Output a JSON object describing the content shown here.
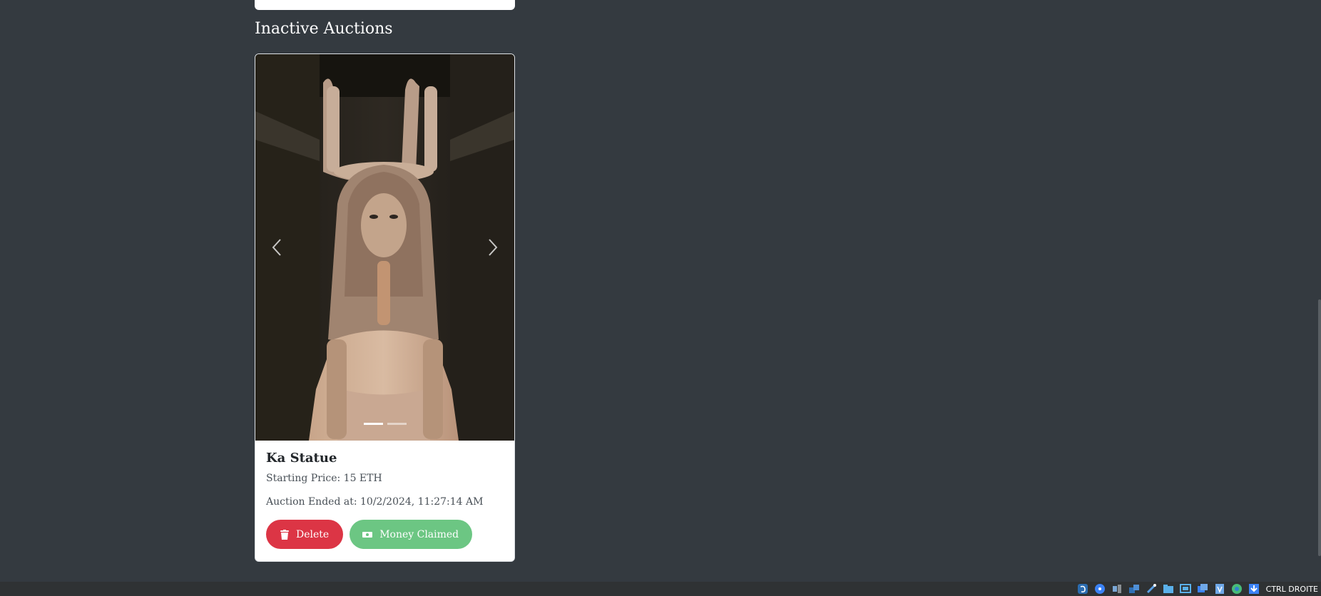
{
  "section": {
    "title": "Inactive Auctions"
  },
  "auction": {
    "title": "Ka Statue",
    "starting_price": "Starting Price: 15 ETH",
    "ended_at": "Auction Ended at: 10/2/2024, 11:27:14 AM",
    "image_alt": "Ka Statue",
    "carousel": {
      "slides": 2,
      "active_slide": 1,
      "prev_icon": "chevron-left-icon",
      "next_icon": "chevron-right-icon"
    },
    "delete_label": "Delete",
    "delete_icon": "trash-icon",
    "claimed_label": "Money Claimed",
    "claimed_icon": "money-bill-icon"
  },
  "taskbar": {
    "hostkey_label": "CTRL DROITE"
  },
  "colors": {
    "page_background": "#343a40",
    "delete": "#dc3545",
    "claimed": "#6cc683"
  }
}
